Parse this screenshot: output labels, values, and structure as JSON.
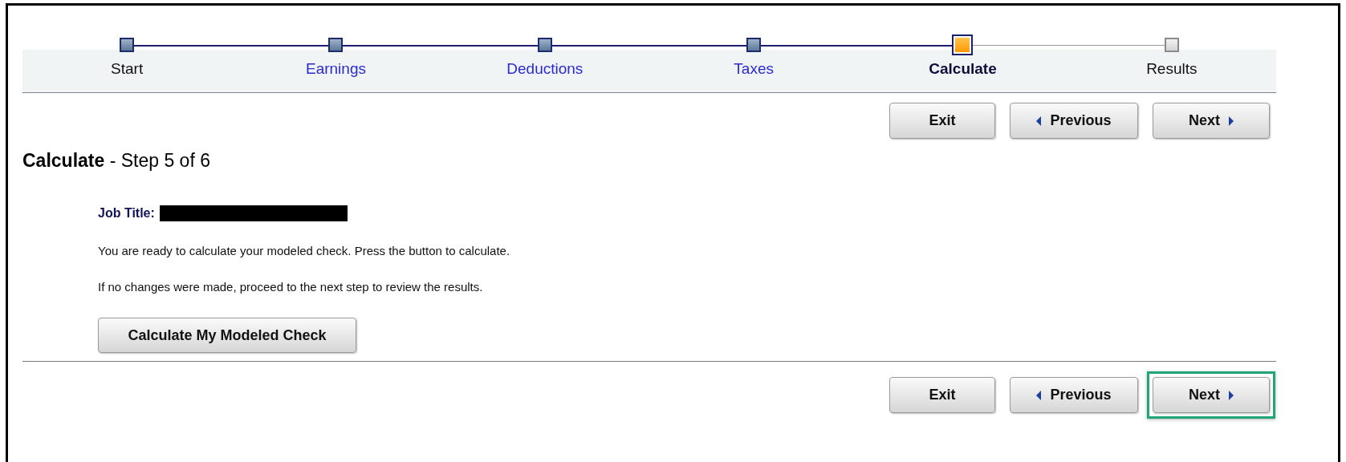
{
  "steps": [
    {
      "label": "Start",
      "completed": true,
      "selected": false,
      "link": false
    },
    {
      "label": "Earnings",
      "completed": true,
      "selected": false,
      "link": true
    },
    {
      "label": "Deductions",
      "completed": true,
      "selected": false,
      "link": true
    },
    {
      "label": "Taxes",
      "completed": true,
      "selected": false,
      "link": true
    },
    {
      "label": "Calculate",
      "completed": false,
      "selected": true,
      "link": false
    },
    {
      "label": "Results",
      "completed": false,
      "selected": false,
      "link": false
    }
  ],
  "top_buttons": [
    {
      "kind": "exit",
      "label": "Exit",
      "highlighted": false
    },
    {
      "kind": "previous",
      "label": "Previous",
      "highlighted": false
    },
    {
      "kind": "next",
      "label": "Next",
      "highlighted": false
    }
  ],
  "heading": {
    "title": "Calculate",
    "subtitle": "- Step 5 of 6"
  },
  "job_title": {
    "label": "Job Title:",
    "redacted": true
  },
  "paragraphs": [
    "You are ready to calculate your modeled check. Press the button to calculate.",
    "If no changes were made, proceed to the next step to review the results."
  ],
  "calculate_button": "Calculate My Modeled Check",
  "bottom_buttons": [
    {
      "kind": "exit",
      "label": "Exit",
      "highlighted": false
    },
    {
      "kind": "previous",
      "label": "Previous",
      "highlighted": false
    },
    {
      "kind": "next",
      "label": "Next",
      "highlighted": true
    }
  ]
}
